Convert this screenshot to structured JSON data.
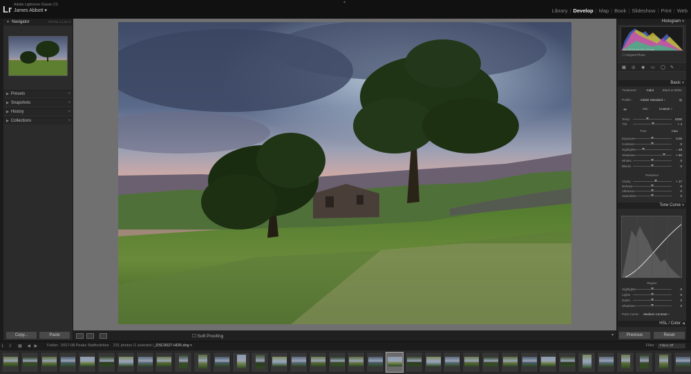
{
  "app": {
    "logo": "Lr",
    "version": "Adobe Lightroom Classic CC",
    "user": "James Abbott",
    "user_caret": "▾"
  },
  "modules": {
    "items": [
      "Library",
      "Develop",
      "Map",
      "Book",
      "Slideshow",
      "Print",
      "Web"
    ],
    "active": "Develop"
  },
  "left_panel": {
    "navigator_title": "Navigator",
    "navigator_modes": "FIT  FILL  1:1  3:1 ⇕",
    "groups": [
      {
        "label": "Presets"
      },
      {
        "label": "Snapshots"
      },
      {
        "label": "History"
      },
      {
        "label": "Collections"
      }
    ],
    "copy_label": "Copy...",
    "paste_label": "Paste"
  },
  "toolbar": {
    "soft_proofing": "Soft Proofing"
  },
  "right_panel": {
    "histogram_title": "Histogram",
    "histogram_readout": "ISO 100   16 mm   f/16   1/13 sec",
    "original_photo": "Original Photo",
    "basic_title": "Basic",
    "treatment": [
      "Treatment :",
      "Color",
      "Black & White"
    ],
    "profile_label": "Profile :",
    "profile_value": "Adobe Standard ÷",
    "wb_label": "WB :",
    "wb_value": "Custom ÷",
    "sliders_wb": [
      {
        "label": "Temp",
        "value": "5200",
        "pos": 0.38
      },
      {
        "label": "Tint",
        "value": "+ 4",
        "pos": 0.52
      }
    ],
    "tone_label": "Tone",
    "tone_auto": "Auto",
    "sliders_tone": [
      {
        "label": "Exposure",
        "value": "0.00",
        "pos": 0.5
      },
      {
        "label": "Contrast",
        "value": "0",
        "pos": 0.5
      },
      {
        "label": "Highlights",
        "value": "− 48",
        "pos": 0.26
      },
      {
        "label": "Shadows",
        "value": "+ 60",
        "pos": 0.8
      },
      {
        "label": "Whites",
        "value": "0",
        "pos": 0.5
      },
      {
        "label": "Blacks",
        "value": "0",
        "pos": 0.5
      }
    ],
    "presence_label": "Presence",
    "sliders_presence": [
      {
        "label": "Clarity",
        "value": "+ 17",
        "pos": 0.59
      },
      {
        "label": "Dehaze",
        "value": "0",
        "pos": 0.5
      },
      {
        "label": "Vibrance",
        "value": "0",
        "pos": 0.5
      },
      {
        "label": "Saturation",
        "value": "0",
        "pos": 0.5
      }
    ],
    "tone_curve_title": "Tone Curve",
    "region_label": "Region",
    "sliders_region": [
      {
        "label": "Highlights",
        "value": "0",
        "pos": 0.5
      },
      {
        "label": "Lights",
        "value": "0",
        "pos": 0.5
      },
      {
        "label": "Darks",
        "value": "0",
        "pos": 0.5
      },
      {
        "label": "Shadows",
        "value": "0",
        "pos": 0.5
      }
    ],
    "point_curve_label": "Point Curve :",
    "point_curve_value": "Medium Contrast ÷",
    "hsl_title": "HSL / Color",
    "previous_label": "Previous",
    "reset_label": "Reset"
  },
  "filmstrip": {
    "page1": "1",
    "page2": "2",
    "folder": "Folder : 2017-08 Peaks Staffordshire",
    "count": "231 photos /1 selected /",
    "filename": "_DSC0027-HDR.dng",
    "filter_label": "Filter :",
    "filter_value": "Filters Off"
  },
  "colors": {
    "sky_top": "#4a5a7a",
    "sunset": "#e8a070",
    "grass": "#6a8a3a",
    "tree": "#1e3012"
  }
}
